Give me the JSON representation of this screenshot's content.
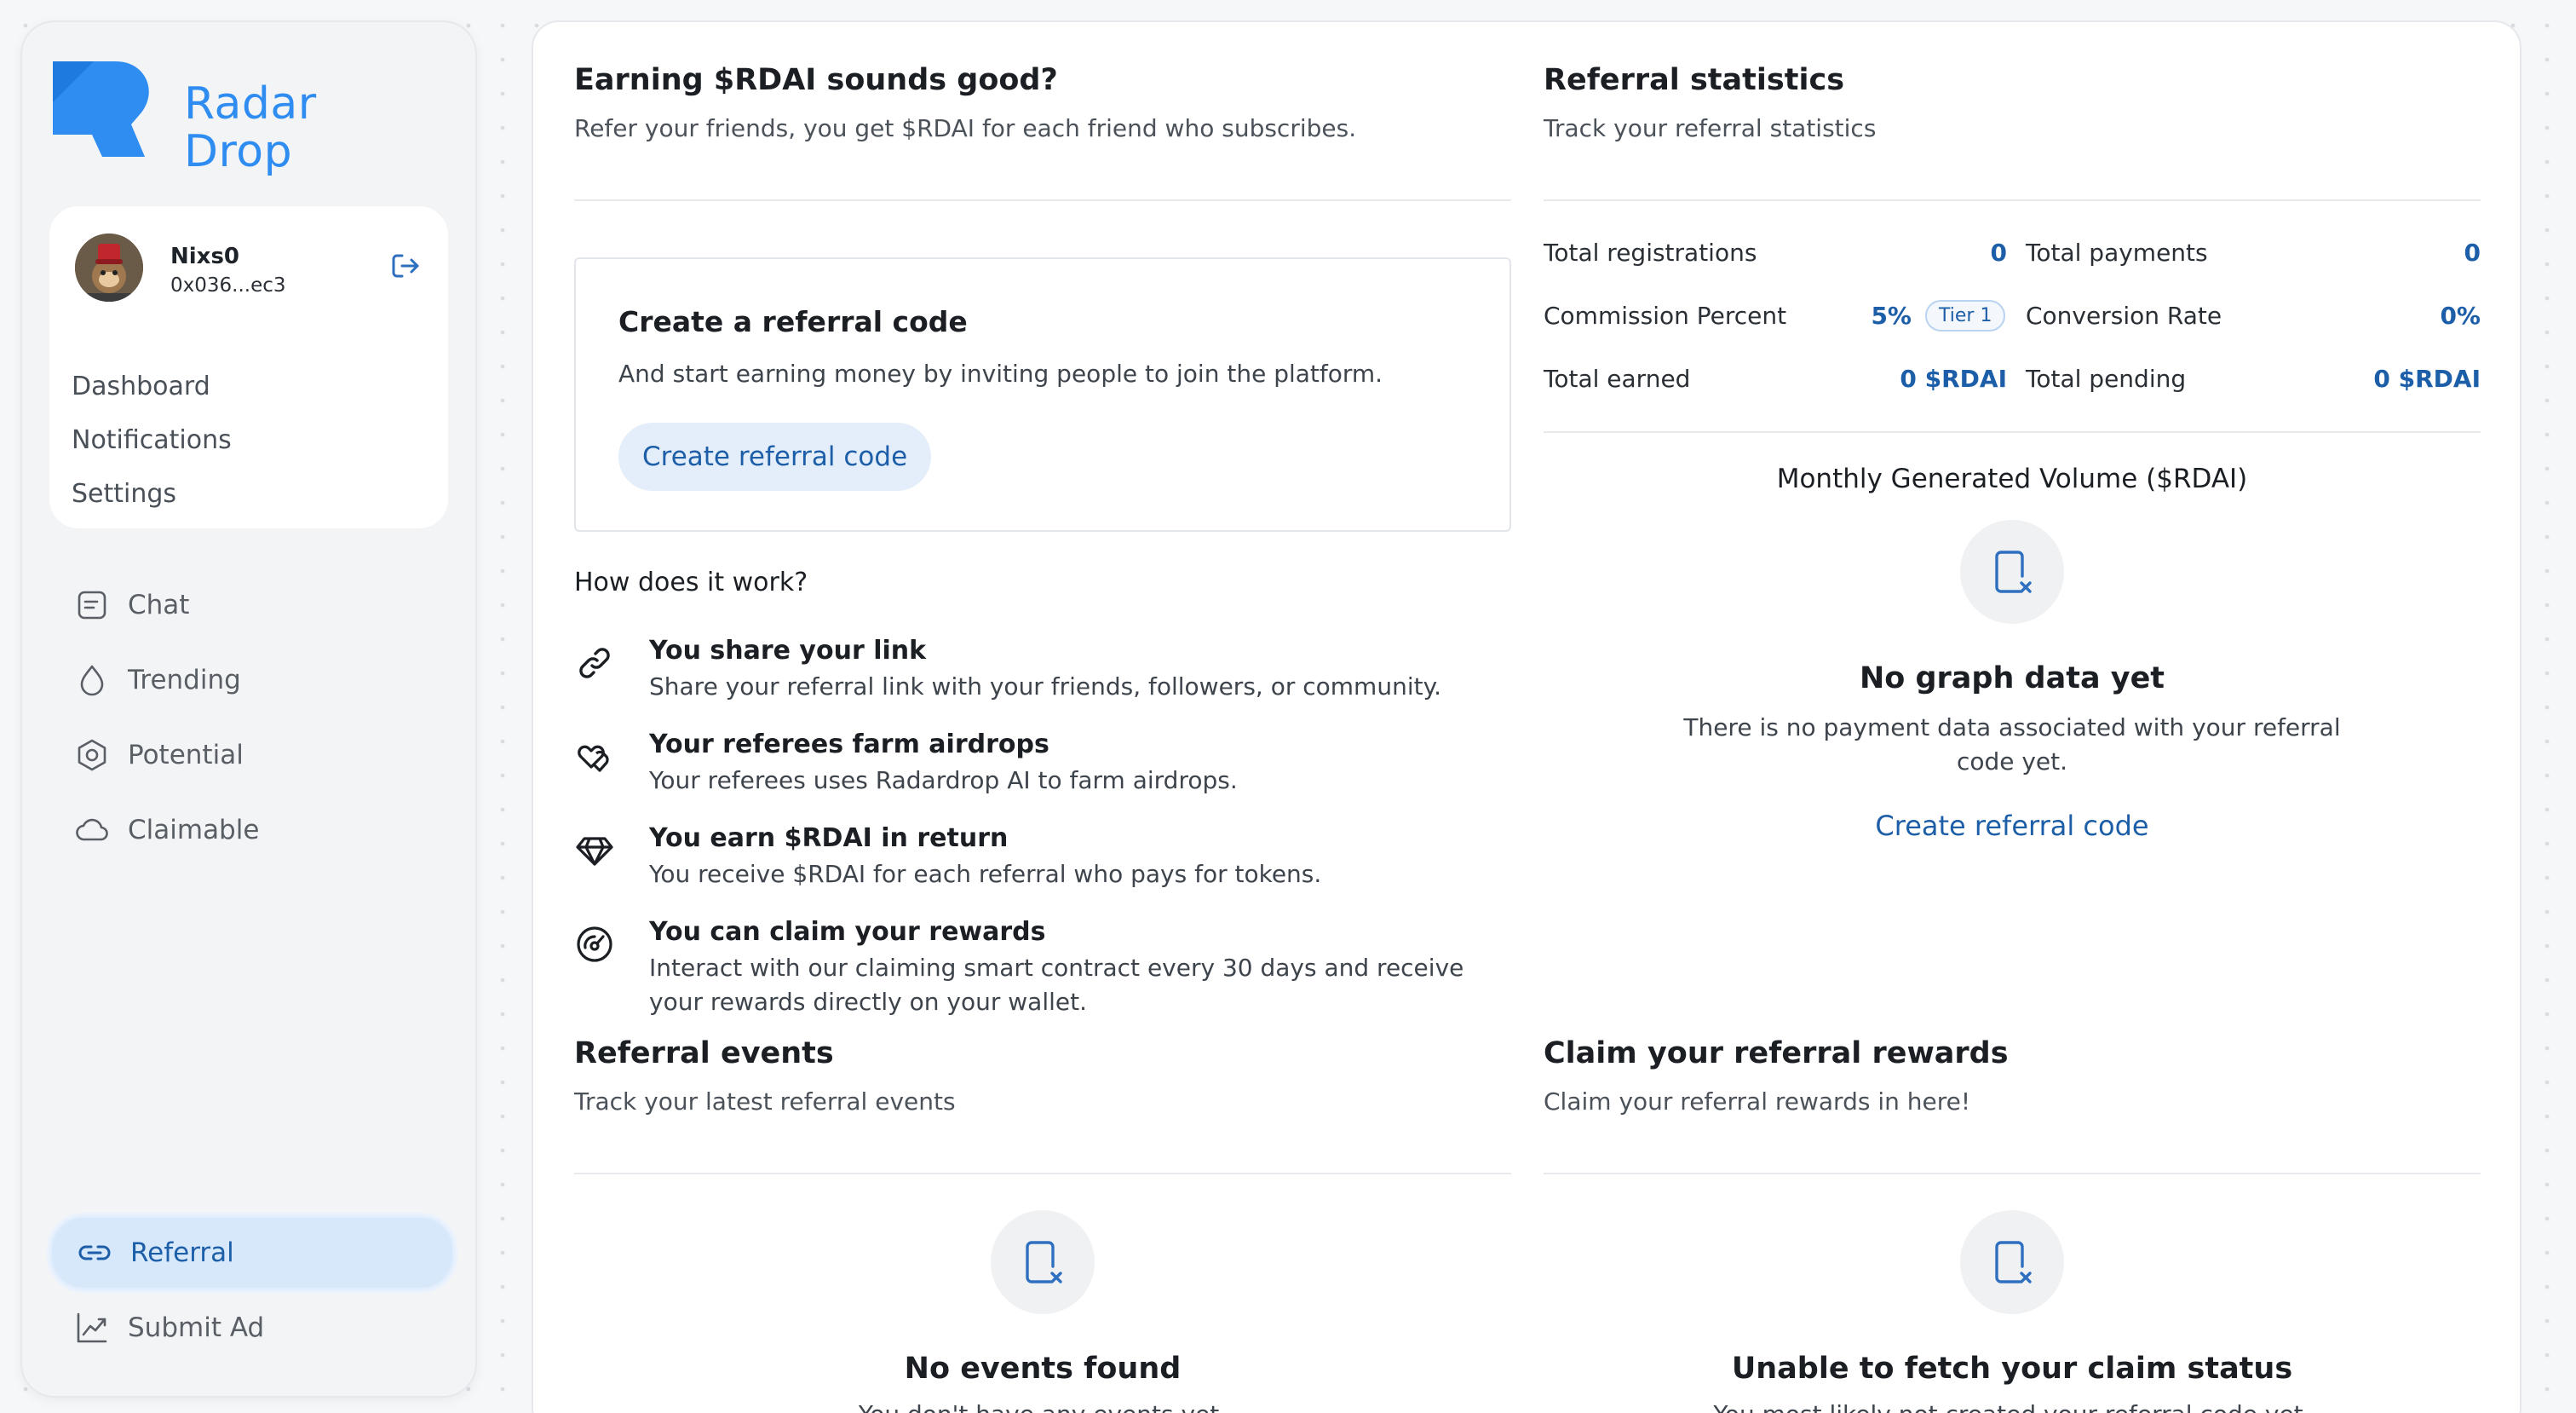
{
  "brand": {
    "line1": "Radar",
    "line2": "Drop",
    "accent": "#2f8cf0"
  },
  "user": {
    "name": "Nixs0",
    "address": "0x036...ec3",
    "links": [
      "Dashboard",
      "Notifications",
      "Settings"
    ]
  },
  "nav": {
    "items": [
      {
        "label": "Chat",
        "icon": "chat-icon"
      },
      {
        "label": "Trending",
        "icon": "flame-icon"
      },
      {
        "label": "Potential",
        "icon": "target-icon"
      },
      {
        "label": "Claimable",
        "icon": "cloud-icon"
      }
    ],
    "bottom": [
      {
        "label": "Referral",
        "icon": "link-icon",
        "active": true
      },
      {
        "label": "Submit Ad",
        "icon": "chart-up-icon"
      }
    ]
  },
  "earning": {
    "title": "Earning $RDAI sounds good?",
    "subtitle": "Refer your friends, you get $RDAI for each friend who subscribes.",
    "create_title": "Create a referral code",
    "create_desc": "And start earning money by inviting people to join the platform.",
    "create_button": "Create referral code",
    "how_title": "How does it work?",
    "steps": [
      {
        "title": "You share your link",
        "desc": "Share your referral link with your friends, followers, or community.",
        "icon": "link-icon"
      },
      {
        "title": "Your referees farm airdrops",
        "desc": "Your referees uses Radardrop AI to farm airdrops.",
        "icon": "hearts-icon"
      },
      {
        "title": "You earn $RDAI in return",
        "desc": "You receive $RDAI for each referral who pays for tokens.",
        "icon": "diamond-icon"
      },
      {
        "title": "You can claim your rewards",
        "desc": "Interact with our claiming smart contract every 30 days and receive your rewards directly on your wallet.",
        "icon": "gauge-icon"
      }
    ]
  },
  "stats": {
    "title": "Referral statistics",
    "subtitle": "Track your referral statistics",
    "total_registrations_label": "Total registrations",
    "total_registrations": "0",
    "total_payments_label": "Total payments",
    "total_payments": "0",
    "commission_label": "Commission Percent",
    "commission": "5%",
    "tier": "Tier 1",
    "conversion_label": "Conversion Rate",
    "conversion": "0%",
    "earned_label": "Total earned",
    "earned": "0 $RDAI",
    "pending_label": "Total pending",
    "pending": "0 $RDAI",
    "graph_title": "Monthly Generated Volume ($RDAI)",
    "empty_title": "No graph data yet",
    "empty_text": "There is no payment data associated with your referral code yet.",
    "empty_link": "Create referral code"
  },
  "events": {
    "title": "Referral events",
    "subtitle": "Track your latest referral events",
    "empty_title": "No events found",
    "empty_text": "You don't have any events yet."
  },
  "claim": {
    "title": "Claim your referral rewards",
    "subtitle": "Claim your referral rewards in here!",
    "empty_title": "Unable to fetch your claim status",
    "empty_text": "You most likely not created your referral code yet."
  }
}
